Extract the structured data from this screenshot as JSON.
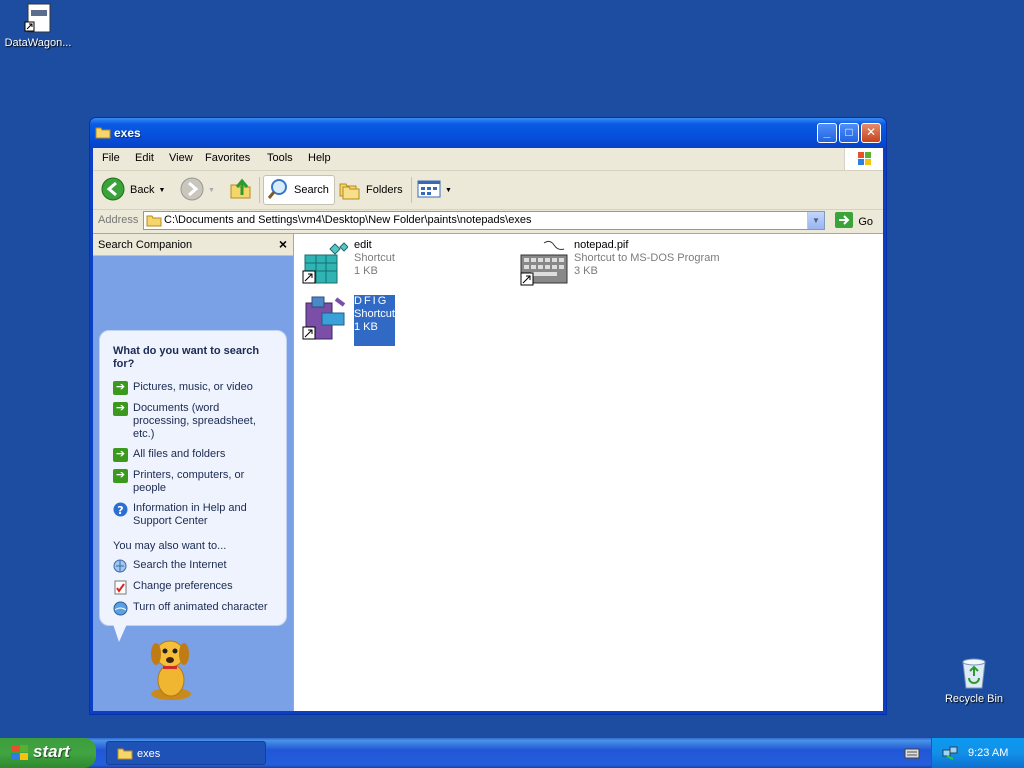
{
  "desktop": {
    "icons": [
      {
        "label": "DataWagon..."
      },
      {
        "label": "Recycle Bin"
      }
    ]
  },
  "window": {
    "title": "exes",
    "menu": [
      "File",
      "Edit",
      "View",
      "Favorites",
      "Tools",
      "Help"
    ],
    "toolbar": {
      "back": "Back",
      "search": "Search",
      "folders": "Folders"
    },
    "address": {
      "label": "Address",
      "path": "C:\\Documents and Settings\\vm4\\Desktop\\New Folder\\paints\\notepads\\exes",
      "go": "Go"
    },
    "companion": {
      "title": "Search Companion",
      "question": "What do you want to search for?",
      "options": [
        "Pictures, music, or video",
        "Documents (word processing, spreadsheet, etc.)",
        "All files and folders",
        "Printers, computers, or people",
        "Information in Help and Support Center"
      ],
      "also_label": "You may also want to...",
      "also": [
        "Search the Internet",
        "Change preferences",
        "Turn off animated character"
      ]
    },
    "files": [
      {
        "name": "edit",
        "type": "Shortcut",
        "size": "1 KB"
      },
      {
        "name": "notepad.pif",
        "type": "Shortcut to MS-DOS Program",
        "size": "3 KB"
      },
      {
        "name": "DFIG",
        "type": "Shortcut",
        "size": "1 KB"
      }
    ]
  },
  "taskbar": {
    "start": "start",
    "task": "exes",
    "clock": "9:23 AM"
  },
  "colors": {
    "desktop": "#1c4da0",
    "titlebar": "#0550dc",
    "selection": "#316ac5",
    "start": "#41a441"
  }
}
